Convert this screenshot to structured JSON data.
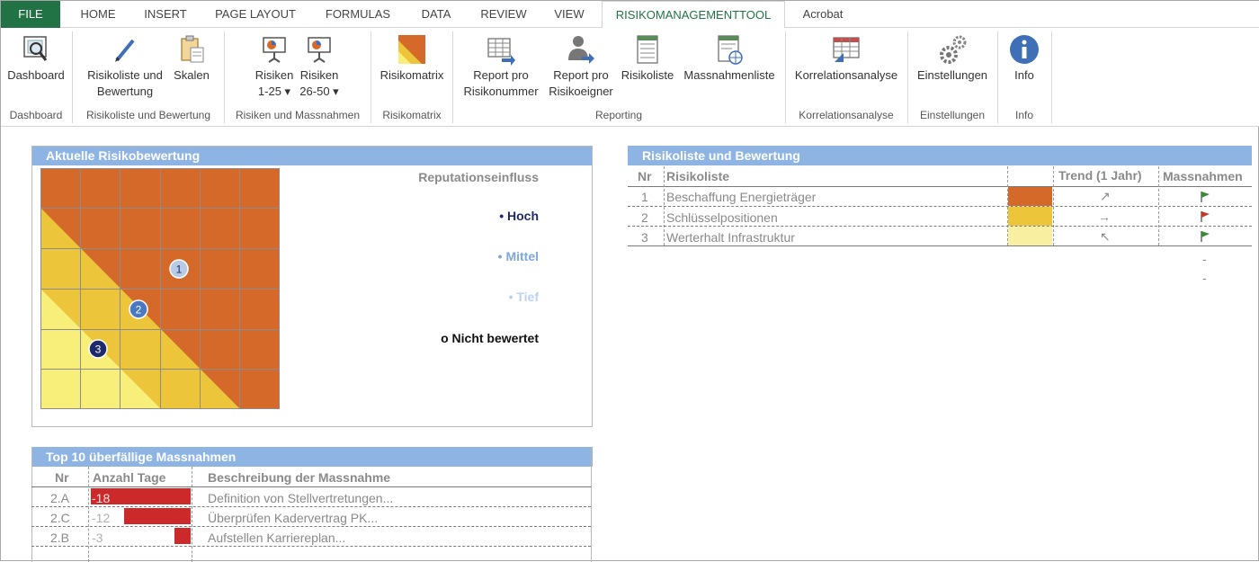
{
  "ribbon": {
    "tabs": [
      "FILE",
      "HOME",
      "INSERT",
      "PAGE LAYOUT",
      "FORMULAS",
      "DATA",
      "REVIEW",
      "VIEW",
      "RISIKOMANAGEMENTTOOL",
      "Acrobat"
    ],
    "buttons": {
      "dashboard": "Dashboard",
      "risikoliste_line1": "Risikoliste und",
      "risikoliste_line2": "Bewertung",
      "skalen": "Skalen",
      "risiken1_line1": "Risiken",
      "risiken1_line2": "1-25 ▾",
      "risiken2_line1": "Risiken",
      "risiken2_line2": "26-50 ▾",
      "risikomatrix": "Risikomatrix",
      "report_nr_line1": "Report pro",
      "report_nr_line2": "Risikonummer",
      "report_eig_line1": "Report pro",
      "report_eig_line2": "Risikoeigner",
      "risikoliste": "Risikoliste",
      "massnahmenliste": "Massnahmenliste",
      "korrelation": "Korrelationsanalyse",
      "einstellungen": "Einstellungen",
      "info": "Info"
    },
    "groups": {
      "dashboard": "Dashboard",
      "risikoliste": "Risikoliste und Bewertung",
      "risiken": "Risiken und Massnahmen",
      "risikomatrix": "Risikomatrix",
      "reporting": "Reporting",
      "korrelation": "Korrelationsanalyse",
      "einstellungen": "Einstellungen",
      "info": "Info"
    }
  },
  "current_panel": {
    "title": "Aktuelle Risikobewertung",
    "legend_title": "Reputationseinfluss",
    "legend": [
      {
        "label": "• Hoch",
        "color": "#1f2a6b"
      },
      {
        "label": "• Mittel",
        "color": "#7ea7dc"
      },
      {
        "label": "• Tief",
        "color": "#bcd1ee"
      },
      {
        "label": "o Nicht bewertet",
        "color": "#111111"
      }
    ],
    "markers": [
      {
        "label": "1",
        "color": "#b8cbe6",
        "text_color": "#1f2a6b"
      },
      {
        "label": "2",
        "color": "#4a78c2",
        "text_color": "#ffffff"
      },
      {
        "label": "3",
        "color": "#1f2a6b",
        "text_color": "#ffffff"
      }
    ],
    "zone_colors": {
      "high": "#d4692a",
      "medium": "#ecc53a",
      "low": "#f8ee7a"
    }
  },
  "risk_list": {
    "title": "Risikoliste und Bewertung",
    "headers": {
      "nr": "Nr",
      "name": "Risikoliste",
      "trend": "Trend (1 Jahr)",
      "massnahmen": "Massnahmen"
    },
    "rows": [
      {
        "nr": "1",
        "name": "Beschaffung Energieträger",
        "color": "#d4692a",
        "trend": "↗",
        "flag_color": "#3a8a3a"
      },
      {
        "nr": "2",
        "name": "Schlüsselpositionen",
        "color": "#ecc53a",
        "trend": "→",
        "flag_color": "#c0392b"
      },
      {
        "nr": "3",
        "name": "Werterhalt Infrastruktur",
        "color": "#f8f0a0",
        "trend": "↖",
        "flag_color": "#3a8a3a"
      }
    ],
    "extra": [
      "-",
      "-"
    ]
  },
  "overdue": {
    "title": "Top 10 überfällige Massnahmen",
    "headers": {
      "nr": "Nr",
      "days": "Anzahl Tage",
      "desc": "Beschreibung der Massnahme"
    },
    "rows": [
      {
        "nr": "2.A",
        "days": -18,
        "label": "-18",
        "desc": "Definition von Stellvertretungen..."
      },
      {
        "nr": "2.C",
        "days": -12,
        "label": "-12",
        "desc": "Überprüfen Kadervertrag PK..."
      },
      {
        "nr": "2.B",
        "days": -3,
        "label": "-3",
        "desc": "Aufstellen Karriereplan..."
      }
    ],
    "bar_color": "#cc2a2a"
  }
}
